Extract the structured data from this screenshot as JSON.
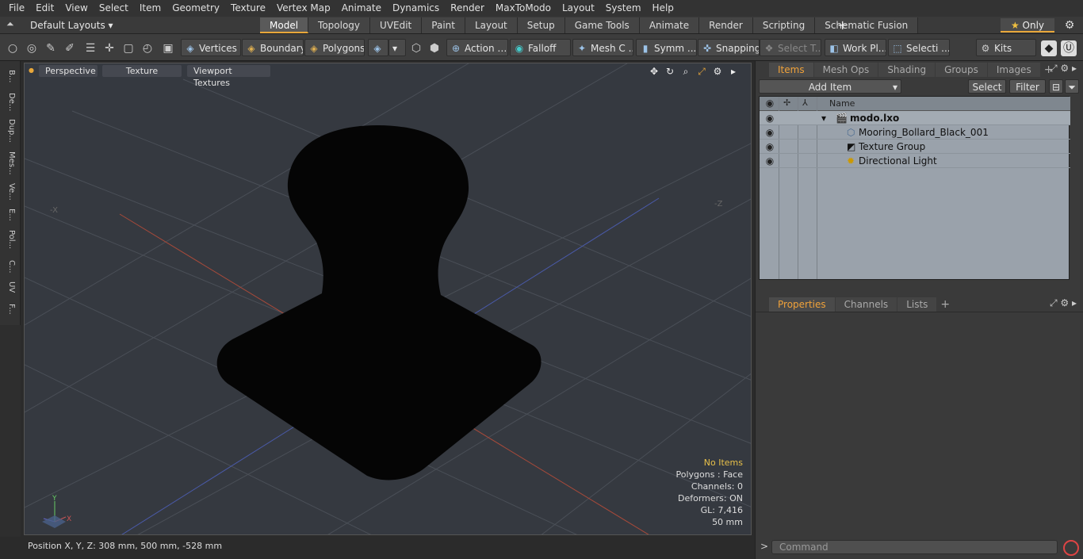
{
  "menu": [
    "File",
    "Edit",
    "View",
    "Select",
    "Item",
    "Geometry",
    "Texture",
    "Vertex Map",
    "Animate",
    "Dynamics",
    "Render",
    "MaxToModo",
    "Layout",
    "System",
    "Help"
  ],
  "layout_dropdown": "Default Layouts",
  "tabs": [
    "Model",
    "Topology",
    "UVEdit",
    "Paint",
    "Layout",
    "Setup",
    "Game Tools",
    "Animate",
    "Render",
    "Scripting",
    "Schematic Fusion"
  ],
  "only_label": "Only",
  "toolbar": {
    "vertices": "Vertices",
    "boundary": "Boundary",
    "polygons": "Polygons",
    "action": "Action",
    "falloff": "Falloff",
    "mesh": "Mesh C ...",
    "symm": "Symm ...",
    "snapping": "Snapping",
    "select_t": "Select T...",
    "work_pl": "Work Pl...",
    "selecti": "Selecti ...",
    "kits": "Kits"
  },
  "left_tabs": [
    "B...",
    "De...",
    "Dup...",
    "Mes...",
    "Ve...",
    "E...",
    "Pol...",
    "C...",
    "UV",
    "F..."
  ],
  "viewport": {
    "perspective": "Perspective",
    "texture": "Texture",
    "viewport_textures": "Viewport Textures",
    "info": {
      "no_items": "No Items",
      "polygons": "Polygons : Face",
      "channels": "Channels: 0",
      "deformers": "Deformers: ON",
      "gl": "GL: 7,416",
      "size": "50 mm"
    }
  },
  "status": "Position X, Y, Z:   308 mm, 500 mm, -528 mm",
  "right": {
    "tabs": [
      "Items",
      "Mesh Ops",
      "Shading",
      "Groups",
      "Images"
    ],
    "add_item": "Add Item",
    "select": "Select",
    "filter": "Filter",
    "name_col": "Name",
    "tree": [
      "modo.lxo",
      "Mooring_Bollard_Black_001",
      "Texture Group",
      "Directional Light"
    ],
    "lower_tabs": [
      "Properties",
      "Channels",
      "Lists"
    ],
    "command_placeholder": "Command"
  }
}
